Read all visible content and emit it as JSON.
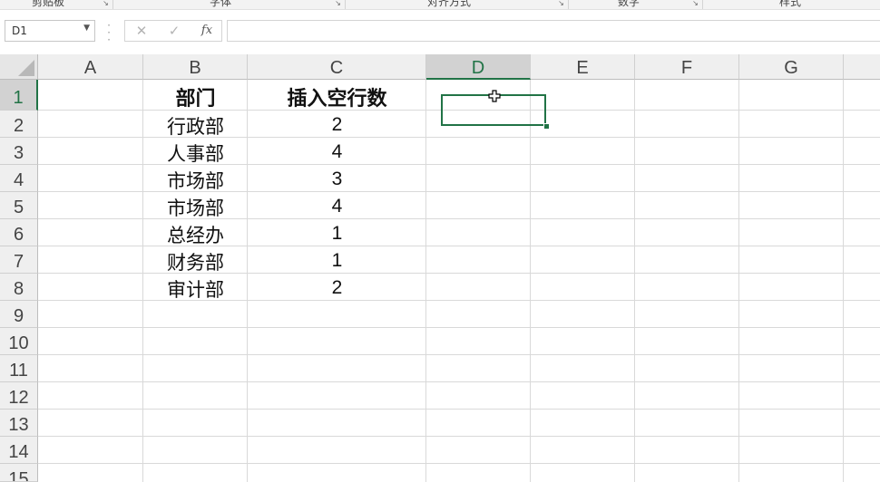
{
  "ribbon": {
    "groups": [
      "剪贴板",
      "字体",
      "对齐方式",
      "数字",
      "样式"
    ]
  },
  "formula_bar": {
    "name_box": "D1",
    "cancel_icon": "close-icon",
    "enter_icon": "check-icon",
    "function_label": "fx",
    "formula_value": ""
  },
  "sheet": {
    "columns": [
      "A",
      "B",
      "C",
      "D",
      "E",
      "F",
      "G"
    ],
    "rows": [
      "1",
      "2",
      "3",
      "4",
      "5",
      "6",
      "7",
      "8",
      "9",
      "10",
      "11",
      "12",
      "13",
      "14",
      "15"
    ],
    "selected_cell": "D1",
    "header": {
      "department": "部门",
      "blank_rows": "插入空行数"
    },
    "records": [
      {
        "department": "行政部",
        "blank_rows": "2"
      },
      {
        "department": "人事部",
        "blank_rows": "4"
      },
      {
        "department": "市场部",
        "blank_rows": "3"
      },
      {
        "department": "市场部",
        "blank_rows": "4"
      },
      {
        "department": "总经办",
        "blank_rows": "1"
      },
      {
        "department": "财务部",
        "blank_rows": "1"
      },
      {
        "department": "审计部",
        "blank_rows": "2"
      }
    ]
  },
  "colors": {
    "accent": "#217346",
    "gridline": "#d9d9d9",
    "header_bg": "#efefef"
  }
}
